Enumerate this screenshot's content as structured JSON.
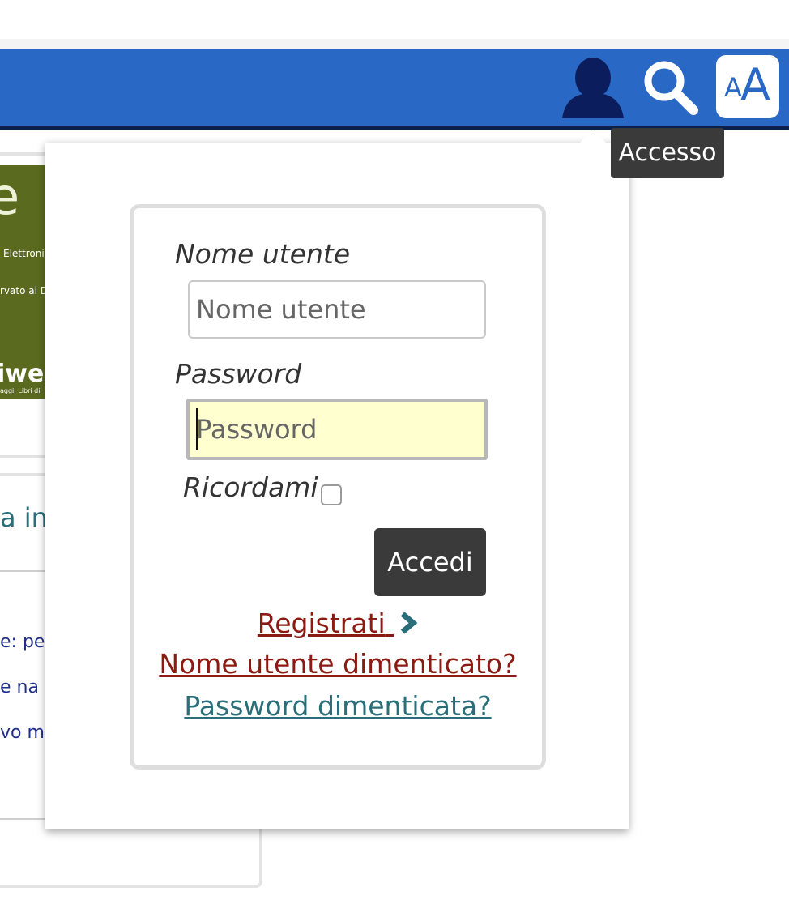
{
  "header": {
    "icons": [
      "user-icon",
      "search-icon",
      "font-size-icon"
    ],
    "font_size_small": "A",
    "font_size_big": "A",
    "accent_color": "#2a68c6"
  },
  "tooltip": {
    "text": "Accesso"
  },
  "background_page": {
    "banner": {
      "letter": "e",
      "line1": "Elettronic",
      "line2": "rvato ai D",
      "line3": "iweb",
      "line4": "aggi, Libri di"
    },
    "heading_fragment": "a in",
    "text_lines": [
      "e:  per",
      "e  na",
      "vo mo"
    ]
  },
  "login": {
    "username_label": "Nome utente",
    "username_placeholder": "Nome utente",
    "password_label": "Password",
    "password_placeholder": "Password",
    "remember_label": "Ricordami",
    "remember_checked": false,
    "submit_label": "Accedi",
    "register_link": "Registrati",
    "forgot_username_link": "Nome utente dimenticato?",
    "forgot_password_link": "Password dimenticata?"
  }
}
